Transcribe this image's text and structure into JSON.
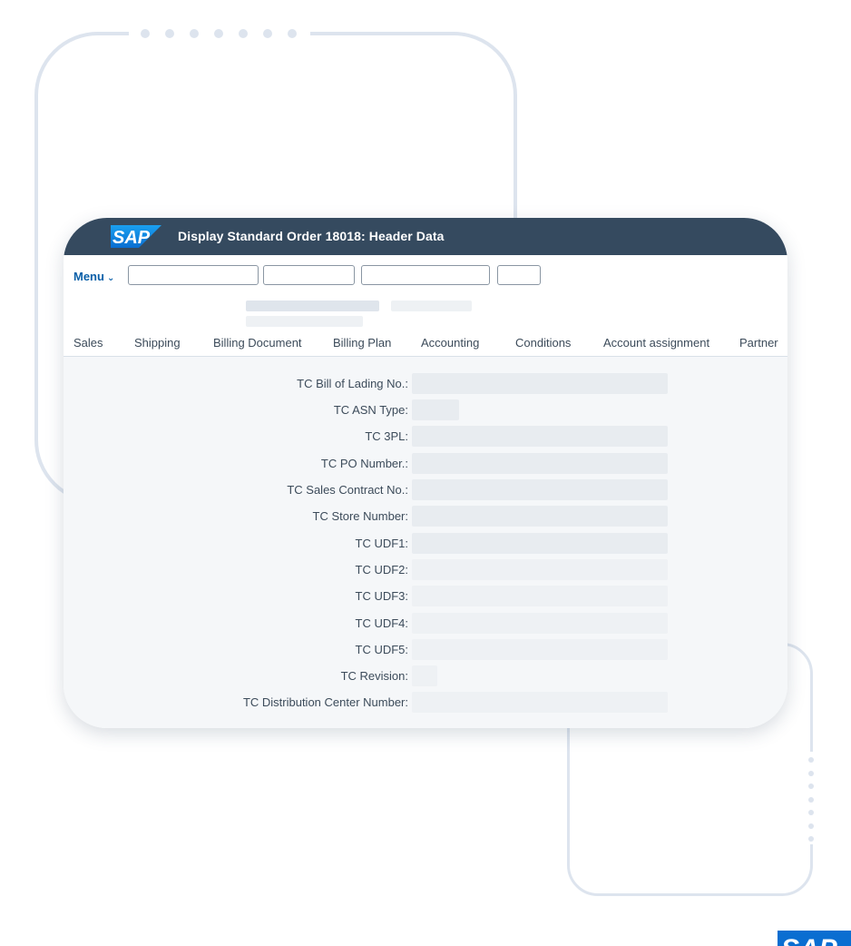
{
  "window": {
    "title": "Display Standard Order 18018: Header Data",
    "logo_text": "SAP"
  },
  "toolbar": {
    "menu_label": "Menu",
    "menu_icon": "chevron-down-icon"
  },
  "tabs": [
    {
      "label": "Sales"
    },
    {
      "label": "Shipping"
    },
    {
      "label": "Billing Document"
    },
    {
      "label": "Billing Plan"
    },
    {
      "label": "Accounting"
    },
    {
      "label": "Conditions"
    },
    {
      "label": "Account assignment"
    },
    {
      "label": "Partner"
    }
  ],
  "fields": [
    {
      "label": "TC Bill of Lading No.:",
      "value": ""
    },
    {
      "label": "TC ASN Type:",
      "value": ""
    },
    {
      "label": "TC 3PL:",
      "value": ""
    },
    {
      "label": "TC PO Number.:",
      "value": ""
    },
    {
      "label": "TC Sales Contract No.:",
      "value": ""
    },
    {
      "label": "TC Store Number:",
      "value": ""
    },
    {
      "label": "TC UDF1:",
      "value": ""
    },
    {
      "label": "TC UDF2:",
      "value": ""
    },
    {
      "label": "TC UDF3:",
      "value": ""
    },
    {
      "label": "TC UDF4:",
      "value": ""
    },
    {
      "label": "TC UDF5:",
      "value": ""
    },
    {
      "label": "TC Revision:",
      "value": ""
    },
    {
      "label": "TC Distribution Center Number:",
      "value": ""
    }
  ],
  "colors": {
    "shell_header": "#354a5f",
    "brand_blue": "#0a6ed1",
    "link_blue": "#0a5fa8",
    "decoration": "#dde4ee"
  }
}
